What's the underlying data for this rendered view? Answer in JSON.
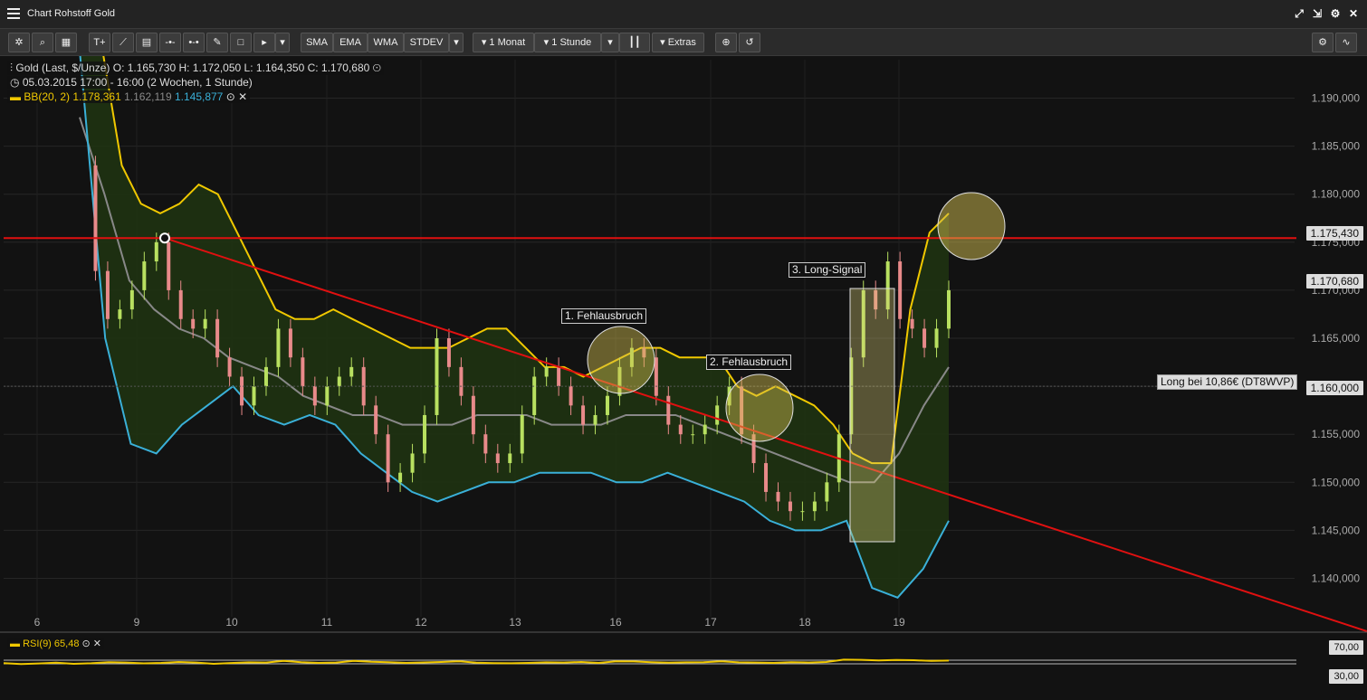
{
  "window": {
    "title": "Chart Rohstoff Gold"
  },
  "toolbar": {
    "indicators": [
      "SMA",
      "EMA",
      "WMA",
      "STDEV"
    ],
    "range": "1 Monat",
    "interval": "1 Stunde",
    "extras": "Extras"
  },
  "legend": {
    "instrument": "Gold (Last, $/Unze)",
    "ohlc": "O: 1.165,730  H: 1.172,050  L: 1.164,350  C: 1.170,680",
    "period": "05.03.2015 17:00 - 16:00 (2 Wochen, 1 Stunde)",
    "bb_name": "BB(20, 2)",
    "bb_upper": "1.178,361",
    "bb_mid": "1.162,119",
    "bb_lower": "1.145,877"
  },
  "rsi": {
    "name": "RSI(9)",
    "value": "65,48",
    "level_high": "70,00",
    "level_low": "30,00"
  },
  "annotations": {
    "fehl1": "1. Fehlausbruch",
    "fehl2": "2. Fehlausbruch",
    "long_signal": "3. Long-Signal",
    "long_note": "Long bei 10,86€ (DT8WVP)"
  },
  "price_tags": {
    "resistance": "1.175,430",
    "last": "1.170,680",
    "ref": "1.160,000"
  },
  "colors": {
    "resistance": "#e01010",
    "trendline": "#e01010",
    "bb_upper": "#f0c800",
    "bb_mid": "#888888",
    "bb_lower": "#3ab0d8",
    "band_fill": "#1f3312",
    "up": "#b8e060",
    "down": "#e88a8a",
    "rsi": "#f0c800"
  },
  "chart_data": {
    "type": "candlestick",
    "title": "Chart Rohstoff Gold",
    "x_tick_labels": [
      "6",
      "9",
      "10",
      "11",
      "12",
      "13",
      "16",
      "17",
      "18",
      "19"
    ],
    "y_tick_labels": [
      "1.190,000",
      "1.185,000",
      "1.180,000",
      "1.175,000",
      "1.170,000",
      "1.165,000",
      "1.160,000",
      "1.155,000",
      "1.150,000",
      "1.145,000",
      "1.140,000"
    ],
    "ylim": [
      1136,
      1194
    ],
    "resistance_level": 1175.43,
    "close_path": [
      1183,
      1172,
      1167,
      1168,
      1170,
      1173,
      1175,
      1170,
      1167,
      1166,
      1167,
      1163,
      1161,
      1158,
      1160,
      1162,
      1166,
      1163,
      1160,
      1158,
      1160,
      1161,
      1162,
      1158,
      1155,
      1150,
      1151,
      1153,
      1157,
      1165,
      1162,
      1159,
      1155,
      1153,
      1152,
      1153,
      1157,
      1161,
      1162,
      1160,
      1158,
      1156,
      1157,
      1159,
      1162,
      1164,
      1163,
      1159,
      1156,
      1155,
      1155,
      1156,
      1158,
      1160,
      1155,
      1152,
      1149,
      1148,
      1147,
      1147,
      1148,
      1150,
      1155,
      1163,
      1170,
      1168,
      1173,
      1167,
      1166,
      1164,
      1166,
      1170
    ],
    "bb_upper_path": [
      1205,
      1195,
      1183,
      1179,
      1178,
      1179,
      1181,
      1180,
      1176,
      1172,
      1168,
      1167,
      1167,
      1168,
      1167,
      1166,
      1165,
      1164,
      1164,
      1164,
      1165,
      1166,
      1166,
      1164,
      1162,
      1162,
      1161,
      1162,
      1163,
      1164,
      1164,
      1163,
      1163,
      1163,
      1160,
      1159,
      1160,
      1159,
      1158,
      1156,
      1153,
      1152,
      1152,
      1168,
      1176,
      1178
    ],
    "bb_mid_path": [
      1188,
      1180,
      1171,
      1168,
      1166,
      1165,
      1163,
      1162,
      1161,
      1159,
      1158,
      1157,
      1157,
      1156,
      1156,
      1156,
      1157,
      1157,
      1157,
      1156,
      1156,
      1156,
      1157,
      1157,
      1157,
      1156,
      1155,
      1154,
      1153,
      1152,
      1151,
      1150,
      1150,
      1153,
      1158,
      1162
    ],
    "bb_lower_path": [
      1195,
      1165,
      1154,
      1153,
      1156,
      1158,
      1160,
      1157,
      1156,
      1157,
      1156,
      1153,
      1151,
      1149,
      1148,
      1149,
      1150,
      1150,
      1151,
      1151,
      1151,
      1150,
      1150,
      1151,
      1150,
      1149,
      1148,
      1146,
      1145,
      1145,
      1146,
      1139,
      1138,
      1141,
      1146
    ],
    "rsi_path": [
      38,
      28,
      34,
      42,
      30,
      36,
      48,
      44,
      35,
      40,
      50,
      44,
      30,
      39,
      46,
      44,
      62,
      48,
      40,
      44,
      62,
      52,
      47,
      40,
      45,
      50,
      58,
      42,
      38,
      36,
      40,
      46,
      44,
      50,
      40,
      58,
      56,
      48,
      42,
      46,
      48,
      58,
      46,
      44,
      40,
      48,
      44,
      50,
      76,
      74,
      68,
      72,
      70,
      62,
      66
    ]
  }
}
